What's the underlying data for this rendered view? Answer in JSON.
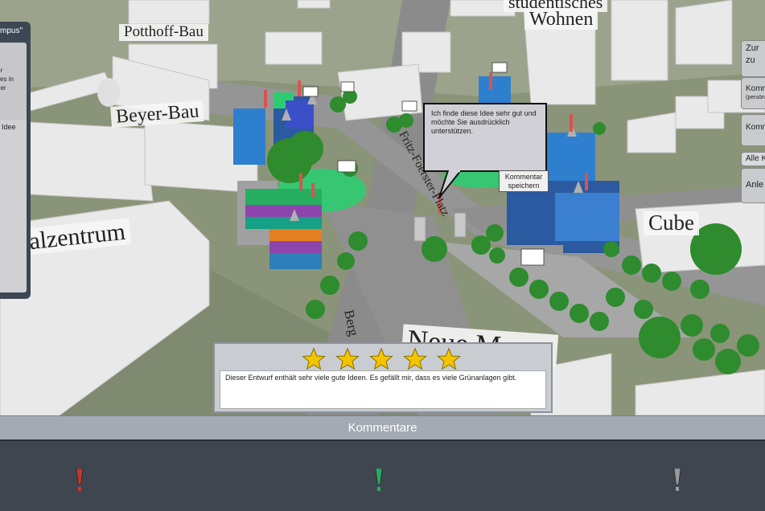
{
  "map": {
    "building_labels": [
      {
        "id": "potthoff",
        "text": "Potthoff-Bau"
      },
      {
        "id": "beyer",
        "text": "Beyer-Bau"
      },
      {
        "id": "zentrum",
        "text": "alzentrum"
      },
      {
        "id": "wohnen",
        "text": "Wohnen"
      },
      {
        "id": "wohnen_top",
        "text": "studentisches"
      },
      {
        "id": "cube",
        "text": "Cube"
      },
      {
        "id": "mensa",
        "text": "Neue Mensa"
      }
    ],
    "street_labels": [
      {
        "id": "fritz",
        "text": "Fritz-Foerster-Platz"
      },
      {
        "id": "berg",
        "text": "Berg"
      }
    ]
  },
  "left_panel": {
    "title": "mpus\"",
    "lines": [
      "er",
      "zes in",
      "der"
    ],
    "idea_label": "Idee"
  },
  "right_panel": {
    "buttons": [
      {
        "line1": "Zur",
        "line2": "zu"
      },
      {
        "line1": "Komme",
        "line2": "(persön"
      },
      {
        "line1": "Komme",
        "line2": ""
      },
      {
        "line1": "Alle K",
        "line2": ""
      },
      {
        "line1": "Anle",
        "line2": ""
      }
    ]
  },
  "comment_bubble": {
    "text": "Ich finde diese Idee sehr gut und möchte Sie ausdrücklich unterstützen.",
    "save_label": "Kommentar speichern"
  },
  "rating": {
    "stars_filled": 5,
    "stars_total": 5,
    "star_color": "#f2c500",
    "comment": "Dieser Entwurf enthält sehr viele gute Ideen. Es gefällt mir, dass es viele Grünanlagen gibt."
  },
  "comments_bar": {
    "title": "Kommentare",
    "markers": [
      {
        "name": "red",
        "color": "#c0392b"
      },
      {
        "name": "green",
        "color": "#27ae60"
      },
      {
        "name": "grey",
        "color": "#9a9a9a"
      }
    ]
  }
}
